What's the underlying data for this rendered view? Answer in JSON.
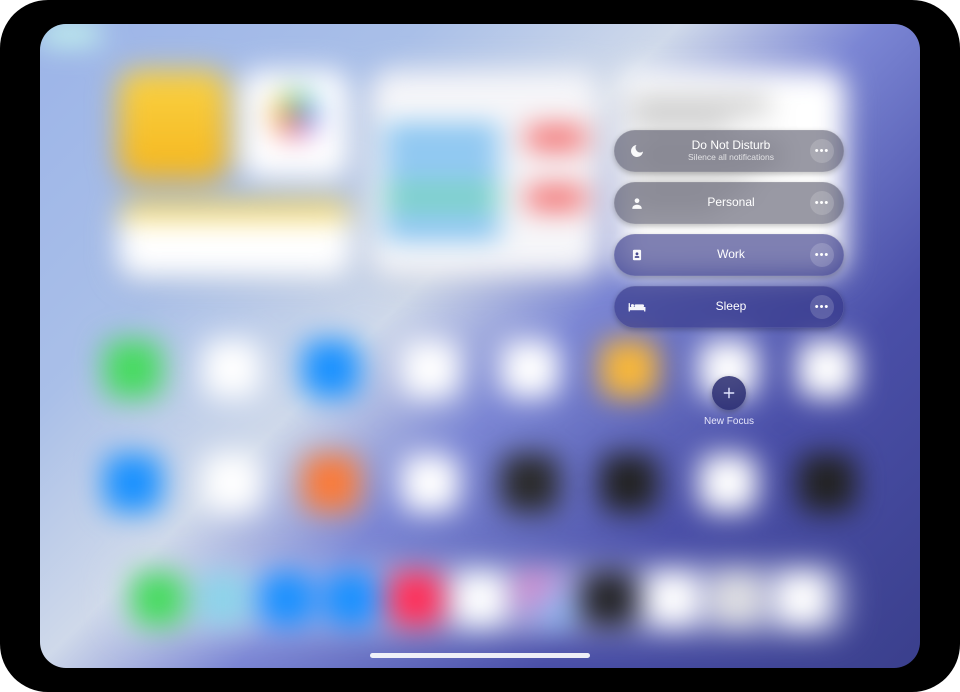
{
  "focus": {
    "items": [
      {
        "title": "Do Not Disturb",
        "subtitle": "Silence all notifications"
      },
      {
        "title": "Personal",
        "subtitle": ""
      },
      {
        "title": "Work",
        "subtitle": ""
      },
      {
        "title": "Sleep",
        "subtitle": ""
      }
    ],
    "new_focus_label": "New Focus"
  },
  "icons": {
    "moon": "moon-icon",
    "person": "person-icon",
    "badge": "badge-icon",
    "bed": "bed-icon",
    "plus": "plus-icon",
    "more": "more-icon"
  }
}
